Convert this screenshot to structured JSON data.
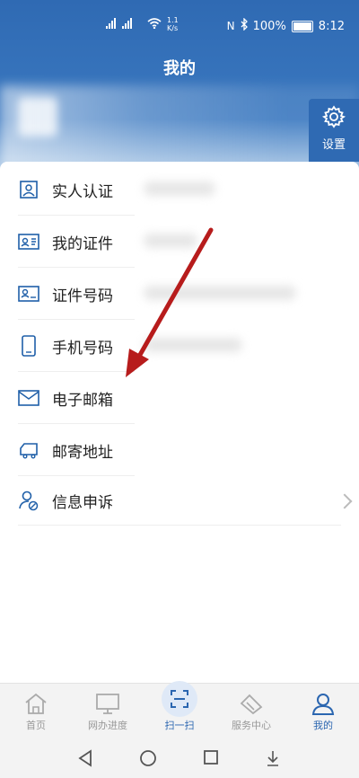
{
  "status_bar": {
    "left_icons": [
      "HD",
      "HD",
      "5G",
      "4G",
      "1.1"
    ],
    "net_speed": "1.1",
    "net_unit": "K/s",
    "battery_percent": "100%",
    "time": "8:12"
  },
  "header": {
    "title": "我的",
    "settings_label": "设置"
  },
  "menu": {
    "items": [
      {
        "label": "实人认证",
        "icon": "id-card-icon"
      },
      {
        "label": "我的证件",
        "icon": "certificate-icon"
      },
      {
        "label": "证件号码",
        "icon": "id-number-icon"
      },
      {
        "label": "手机号码",
        "icon": "phone-icon"
      },
      {
        "label": "电子邮箱",
        "icon": "mail-icon"
      },
      {
        "label": "邮寄地址",
        "icon": "delivery-truck-icon"
      },
      {
        "label": "信息申诉",
        "icon": "user-appeal-icon"
      }
    ]
  },
  "tabbar": {
    "items": [
      {
        "label": "首页",
        "icon": "home-icon"
      },
      {
        "label": "网办进度",
        "icon": "monitor-icon"
      },
      {
        "label": "扫一扫",
        "icon": "scan-icon"
      },
      {
        "label": "服务中心",
        "icon": "service-icon"
      },
      {
        "label": "我的",
        "icon": "user-icon"
      }
    ],
    "active": "我的"
  },
  "system_nav": [
    "back-icon",
    "home-circle-icon",
    "recents-icon",
    "download-icon"
  ],
  "colors": {
    "brand_blue": "#2f6ab3",
    "annotation_red": "#b71c1c",
    "tab_active": "#2b66b0"
  }
}
